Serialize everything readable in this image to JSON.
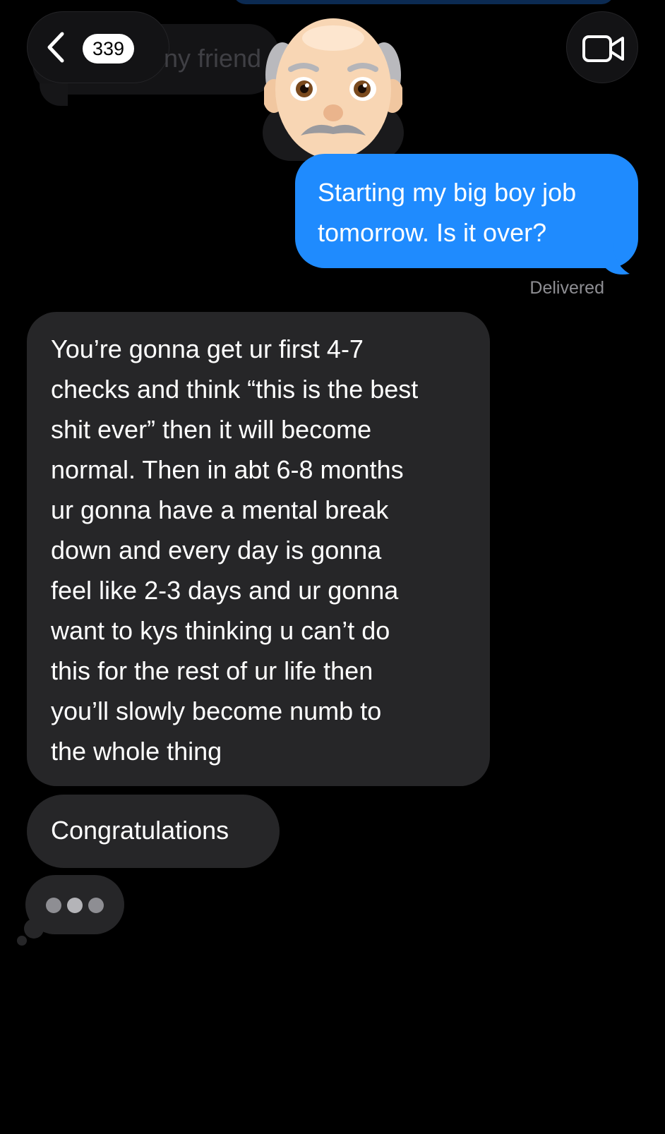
{
  "header": {
    "unread_count": "339",
    "contact_name_partial": "ny friend",
    "video_call_icon": "video-camera-icon",
    "back_icon": "chevron-left-icon",
    "avatar_icon": "old-man-memoji"
  },
  "background_fragment": {
    "text": "I think my friend"
  },
  "messages": [
    {
      "direction": "sent",
      "lines": [
        "Starting my big boy job",
        "tomorrow. Is it over?"
      ]
    },
    {
      "direction": "received",
      "lines": [
        "You’re gonna get ur first 4-7",
        "checks and think “this is the best",
        "shit ever” then it will become",
        "normal. Then in abt 6-8 months",
        "ur gonna have a mental break",
        "down and every day is gonna",
        "feel like 2-3 days and ur gonna",
        "want to kys thinking u can’t do",
        "this for the rest of ur life then",
        "you’ll slowly become numb to",
        "the whole thing"
      ]
    },
    {
      "direction": "received",
      "text": "Congratulations"
    }
  ],
  "status": {
    "delivered": "Delivered",
    "typing_indicator": "typing-dots"
  },
  "colors": {
    "background": "#000000",
    "sent_bubble": "#1f8bfe",
    "received_bubble": "#262628",
    "status_text": "#8e8e93"
  }
}
